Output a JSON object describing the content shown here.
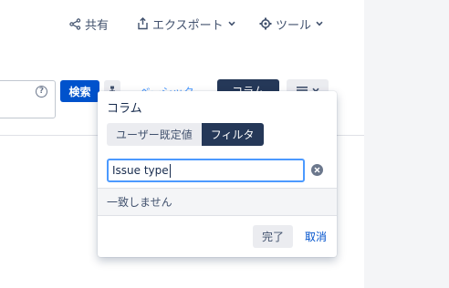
{
  "header": {
    "share_label": "共有",
    "export_label": "エクスポート",
    "tools_label": "ツール"
  },
  "search_bar": {
    "search_button_label": "検索",
    "basic_link_label": "ベーシック",
    "columns_button_label": "コラム",
    "help_glyph": "?"
  },
  "columns_popup": {
    "title": "コラム",
    "tabs": [
      {
        "label": "ユーザー既定値",
        "active": false
      },
      {
        "label": "フィルタ",
        "active": true
      }
    ],
    "filter_input_value": "Issue type",
    "no_match_text": "一致しません",
    "done_label": "完了",
    "cancel_label": "取消"
  },
  "colors": {
    "primary_blue": "#0052cc",
    "dark_navy": "#253858",
    "focus_blue": "#4c9aff",
    "light_gray": "#ebecf0",
    "panel_gray": "#f4f5f7"
  }
}
